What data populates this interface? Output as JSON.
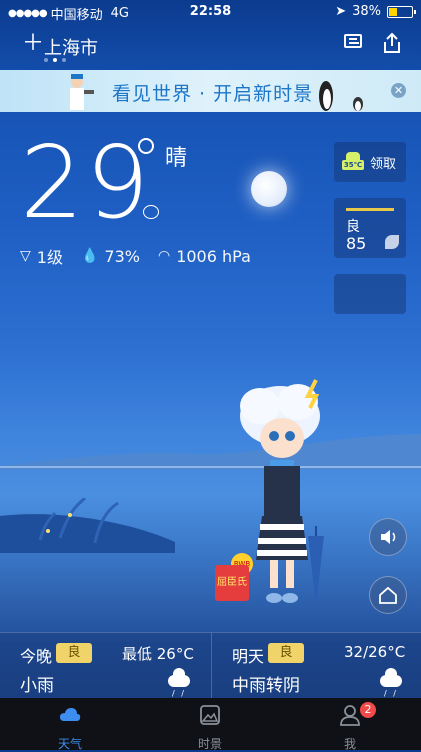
{
  "status_bar": {
    "signal": "●●●●●",
    "carrier": "中国移动",
    "network": "4G",
    "time": "22:58",
    "battery": "38%",
    "battery_level": 0.38
  },
  "header": {
    "city": "上海市",
    "add_icon": "plus-icon",
    "news_icon": "news-icon",
    "share_icon": "share-icon",
    "page_count": 3,
    "active_page": 1
  },
  "banner": {
    "text": "看见世界 · 开启新时景",
    "close_icon": "close-icon"
  },
  "current": {
    "temperature": "29",
    "condition": "晴",
    "wind": "1级",
    "humidity": "73%",
    "pressure": "1006 hPa"
  },
  "cards": {
    "reward_label": "领取",
    "reward_badge": "35℃",
    "aqi_label": "良",
    "aqi_value": "85"
  },
  "mascot_badge": "屈臣氏",
  "forecast": [
    {
      "day": "今晚",
      "aqi": "良",
      "range": "最低 26°C",
      "desc": "小雨",
      "icon": "rain-cloud-icon"
    },
    {
      "day": "明天",
      "aqi": "良",
      "range": "32/26°C",
      "desc": "中雨转阴",
      "icon": "rain-cloud-icon"
    }
  ],
  "tabs": [
    {
      "label": "天气",
      "icon": "cloud-icon",
      "active": true
    },
    {
      "label": "时景",
      "icon": "photo-icon",
      "active": false
    },
    {
      "label": "我",
      "icon": "person-icon",
      "active": false,
      "badge": "2"
    }
  ],
  "colors": {
    "tab_active": "#3d8df0",
    "aqi_good": "#f1d469",
    "badge_red": "#f04a4a"
  }
}
